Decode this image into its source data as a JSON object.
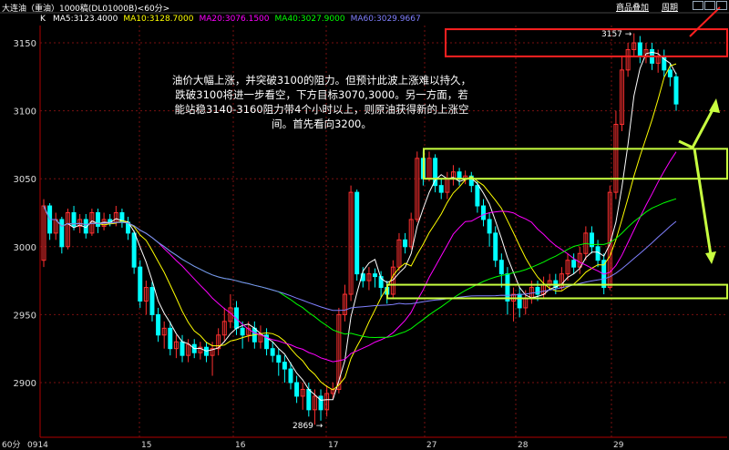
{
  "header": {
    "symbol": "大连油（重油）1000稿(DL01000B)<60分>",
    "ma_labels": [
      {
        "text": "MA5:3123.4000",
        "color": "#ffffff"
      },
      {
        "text": "MA10:3128.7000",
        "color": "#ffff00"
      },
      {
        "text": "MA20:3076.1500",
        "color": "#ff00ff"
      },
      {
        "text": "MA40:3027.9000",
        "color": "#00ff00"
      },
      {
        "text": "MA60:3029.9667",
        "color": "#8080ff"
      }
    ],
    "k_label": "K",
    "link_add": "商品叠加",
    "link_period": "周期"
  },
  "annotation": "油价大幅上涨，并突破3100的阻力。但预计此波上涨难以持久，跌破3100将进一步看空，下方目标3070,3000。另一方面，若能站稳3140-3160阻力带4个小时以上，则原油获得新的上涨空间。首先看向3200。",
  "colors": {
    "up": "#ff3030",
    "down": "#00ffff",
    "grid": "#7a1010",
    "axis": "#b00000",
    "box_red": "#ff2020",
    "box_green": "#c8ff40"
  },
  "chart_data": {
    "type": "candlestick",
    "y_ticks": [
      2900,
      2950,
      3000,
      3050,
      3100,
      3150
    ],
    "ylim": [
      2850,
      3170
    ],
    "x_labels": [
      "60分",
      "0914",
      "15",
      "16",
      "17",
      "27",
      "28",
      "29"
    ],
    "high_label": "3157",
    "low_label": "2869",
    "zones": [
      {
        "name": "resistance-3140-3160",
        "low": 3140,
        "high": 3160,
        "color": "red"
      },
      {
        "name": "zone-3050-3072",
        "low": 3050,
        "high": 3072,
        "color": "green"
      },
      {
        "name": "zone-2962-2972",
        "low": 2962,
        "high": 2972,
        "color": "green"
      }
    ],
    "candles": [
      [
        2990,
        3030,
        3035,
        2985
      ],
      [
        3030,
        3010,
        3032,
        3005
      ],
      [
        3010,
        3020,
        3025,
        3005
      ],
      [
        3020,
        3000,
        3022,
        2995
      ],
      [
        3000,
        3025,
        3028,
        2998
      ],
      [
        3025,
        3015,
        3030,
        3012
      ],
      [
        3015,
        3020,
        3024,
        3010
      ],
      [
        3020,
        3010,
        3024,
        3006
      ],
      [
        3010,
        3025,
        3028,
        3008
      ],
      [
        3025,
        3015,
        3028,
        3010
      ],
      [
        3015,
        3020,
        3025,
        3012
      ],
      [
        3020,
        3018,
        3024,
        3015
      ],
      [
        3018,
        3025,
        3030,
        3015
      ],
      [
        3025,
        3018,
        3028,
        3014
      ],
      [
        3018,
        3010,
        3022,
        3005
      ],
      [
        3010,
        2985,
        3012,
        2980
      ],
      [
        2985,
        2960,
        2990,
        2955
      ],
      [
        2960,
        2970,
        2975,
        2950
      ],
      [
        2970,
        2950,
        2974,
        2945
      ],
      [
        2950,
        2935,
        2955,
        2930
      ],
      [
        2935,
        2940,
        2945,
        2925
      ],
      [
        2940,
        2925,
        2945,
        2920
      ],
      [
        2925,
        2930,
        2935,
        2918
      ],
      [
        2930,
        2920,
        2935,
        2915
      ],
      [
        2920,
        2928,
        2932,
        2915
      ],
      [
        2928,
        2922,
        2932,
        2918
      ],
      [
        2922,
        2926,
        2930,
        2917
      ],
      [
        2926,
        2920,
        2930,
        2915
      ],
      [
        2920,
        2925,
        2930,
        2905
      ],
      [
        2925,
        2935,
        2940,
        2920
      ],
      [
        2935,
        2945,
        2955,
        2930
      ],
      [
        2945,
        2955,
        2965,
        2940
      ],
      [
        2955,
        2940,
        2960,
        2935
      ],
      [
        2940,
        2935,
        2945,
        2925
      ],
      [
        2935,
        2940,
        2945,
        2930
      ],
      [
        2940,
        2930,
        2945,
        2925
      ],
      [
        2930,
        2935,
        2942,
        2925
      ],
      [
        2935,
        2925,
        2940,
        2920
      ],
      [
        2925,
        2920,
        2930,
        2915
      ],
      [
        2920,
        2915,
        2925,
        2905
      ],
      [
        2915,
        2910,
        2920,
        2900
      ],
      [
        2910,
        2900,
        2915,
        2895
      ],
      [
        2900,
        2890,
        2905,
        2885
      ],
      [
        2890,
        2895,
        2900,
        2880
      ],
      [
        2895,
        2880,
        2900,
        2875
      ],
      [
        2880,
        2890,
        2895,
        2869
      ],
      [
        2890,
        2880,
        2895,
        2872
      ],
      [
        2880,
        2892,
        2898,
        2875
      ],
      [
        2892,
        2895,
        2900,
        2888
      ],
      [
        2895,
        2950,
        2955,
        2892
      ],
      [
        2950,
        2965,
        2972,
        2945
      ],
      [
        2965,
        3040,
        3045,
        2960
      ],
      [
        3040,
        2980,
        3042,
        2975
      ],
      [
        2980,
        2975,
        2985,
        2970
      ],
      [
        2975,
        2980,
        2985,
        2968
      ],
      [
        2980,
        2978,
        2984,
        2970
      ],
      [
        2978,
        2970,
        2982,
        2962
      ],
      [
        2970,
        2965,
        2975,
        2958
      ],
      [
        2965,
        2985,
        2990,
        2962
      ],
      [
        2985,
        3005,
        3010,
        2982
      ],
      [
        3005,
        3000,
        3010,
        2995
      ],
      [
        3000,
        3020,
        3025,
        2998
      ],
      [
        3020,
        3065,
        3070,
        3018
      ],
      [
        3065,
        3050,
        3070,
        3045
      ],
      [
        3050,
        3065,
        3070,
        3048
      ],
      [
        3065,
        3045,
        3068,
        3040
      ],
      [
        3045,
        3040,
        3050,
        3035
      ],
      [
        3040,
        3050,
        3055,
        3035
      ],
      [
        3050,
        3055,
        3060,
        3045
      ],
      [
        3055,
        3050,
        3058,
        3045
      ],
      [
        3050,
        3052,
        3056,
        3046
      ],
      [
        3052,
        3045,
        3055,
        3040
      ],
      [
        3045,
        3030,
        3048,
        3025
      ],
      [
        3030,
        3020,
        3035,
        3015
      ],
      [
        3020,
        3010,
        3025,
        3000
      ],
      [
        3010,
        2990,
        3015,
        2985
      ],
      [
        2990,
        2980,
        2995,
        2970
      ],
      [
        2980,
        2960,
        2985,
        2950
      ],
      [
        2960,
        2965,
        2970,
        2945
      ],
      [
        2965,
        2955,
        2970,
        2948
      ],
      [
        2955,
        2962,
        2968,
        2950
      ],
      [
        2962,
        2970,
        2975,
        2958
      ],
      [
        2970,
        2965,
        2975,
        2960
      ],
      [
        2965,
        2972,
        2978,
        2962
      ],
      [
        2972,
        2975,
        2980,
        2968
      ],
      [
        2975,
        2970,
        2980,
        2965
      ],
      [
        2970,
        2980,
        2985,
        2968
      ],
      [
        2980,
        2990,
        2995,
        2975
      ],
      [
        2990,
        2985,
        2995,
        2980
      ],
      [
        2985,
        2995,
        3000,
        2980
      ],
      [
        2995,
        3010,
        3015,
        2990
      ],
      [
        3010,
        3000,
        3015,
        2995
      ],
      [
        3000,
        2990,
        3005,
        2985
      ],
      [
        2990,
        2970,
        2995,
        2965
      ],
      [
        2970,
        3040,
        3045,
        2968
      ],
      [
        3040,
        3090,
        3100,
        3035
      ],
      [
        3090,
        3130,
        3140,
        3085
      ],
      [
        3130,
        3145,
        3150,
        3125
      ],
      [
        3145,
        3150,
        3157,
        3140
      ],
      [
        3150,
        3140,
        3155,
        3135
      ],
      [
        3140,
        3145,
        3150,
        3135
      ],
      [
        3145,
        3135,
        3150,
        3130
      ],
      [
        3135,
        3140,
        3145,
        3128
      ],
      [
        3140,
        3130,
        3145,
        3125
      ],
      [
        3130,
        3125,
        3135,
        3118
      ],
      [
        3125,
        3105,
        3128,
        3100
      ]
    ],
    "arrows_note": "projection arrows toward 3200 and 3000"
  }
}
